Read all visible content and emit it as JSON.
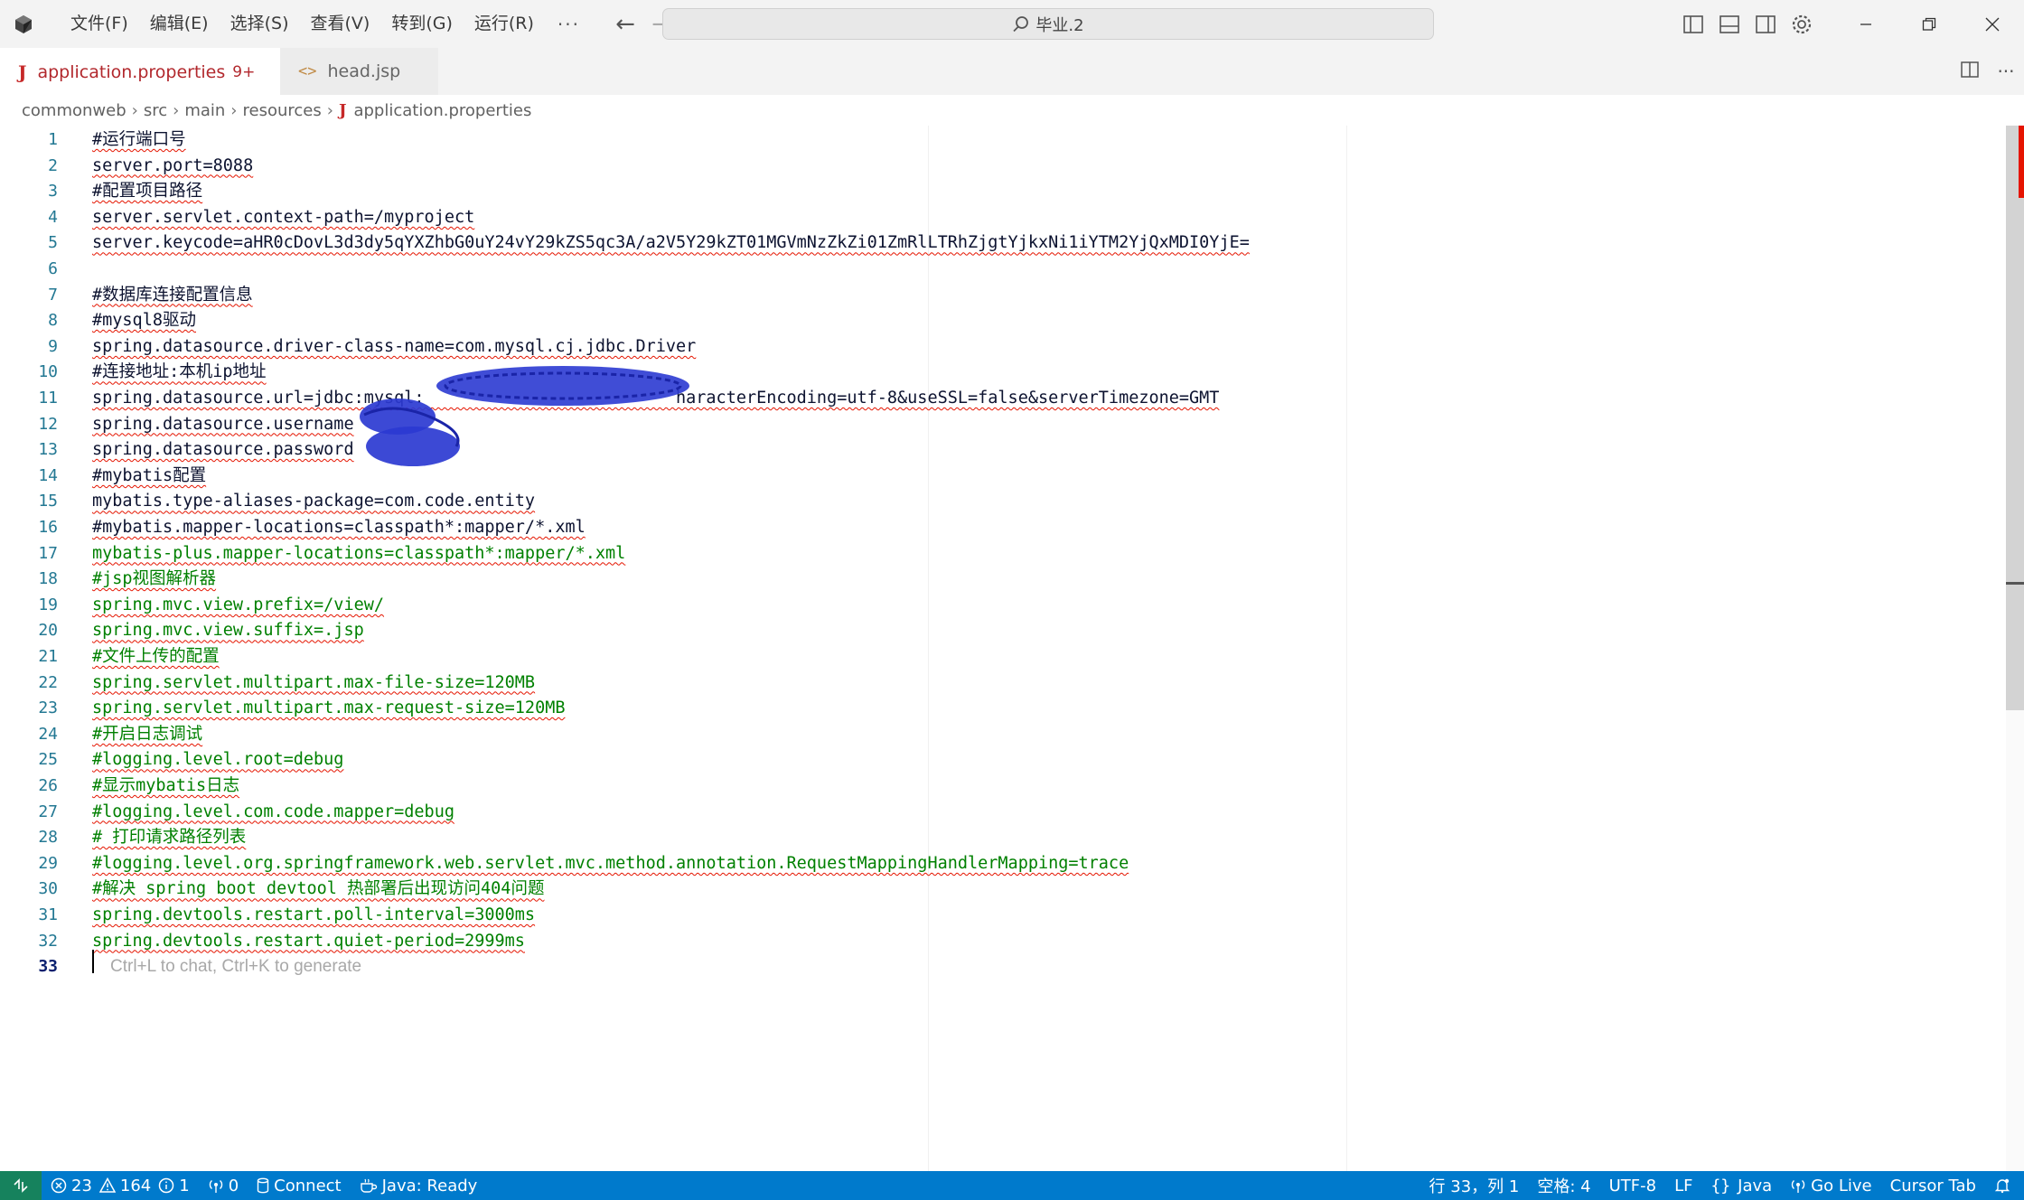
{
  "menu": [
    "文件(F)",
    "编辑(E)",
    "选择(S)",
    "查看(V)",
    "转到(G)",
    "运行(R)"
  ],
  "menu_more": "···",
  "search": {
    "text": "毕业.2"
  },
  "tabs": [
    {
      "label": "application.properties",
      "badge": "9+",
      "modified": true,
      "active": true,
      "icon": "java-icon"
    },
    {
      "label": "head.jsp",
      "active": false,
      "icon": "code-icon"
    }
  ],
  "breadcrumb": [
    "commonweb",
    "src",
    "main",
    "resources",
    "application.properties"
  ],
  "editor": {
    "current_line": 33,
    "ghost_hint": "Ctrl+L to chat, Ctrl+K to generate",
    "lines": [
      {
        "n": "1",
        "text": "#运行端口号",
        "kind": "key"
      },
      {
        "n": "2",
        "text": "server.port=8088",
        "kind": "key"
      },
      {
        "n": "3",
        "text": "#配置项目路径",
        "kind": "key"
      },
      {
        "n": "4",
        "text": "server.servlet.context-path=/myproject",
        "kind": "key"
      },
      {
        "n": "5",
        "text": "server.keycode=aHR0cDovL3d3dy5qYXZhbG0uY24vY29kZS5qc3A/a2V5Y29kZT01MGVmNzZkZi01ZmRlLTRhZjgtYjkxNi1iYTM2YjQxMDI0YjE=",
        "kind": "key"
      },
      {
        "n": "6",
        "text": "",
        "kind": "plain"
      },
      {
        "n": "7",
        "text": "#数据库连接配置信息",
        "kind": "key"
      },
      {
        "n": "8",
        "text": "#mysql8驱动",
        "kind": "key"
      },
      {
        "n": "9",
        "text": "spring.datasource.driver-class-name=com.mysql.cj.jdbc.Driver",
        "kind": "key"
      },
      {
        "n": "10",
        "text": "#连接地址:本机ip地址",
        "kind": "key"
      },
      {
        "n": "11",
        "text": "spring.datasource.url=jdbc:mysql:                         haracterEncoding=utf-8&useSSL=false&serverTimezone=GMT",
        "kind": "key"
      },
      {
        "n": "12",
        "text": "spring.datasource.username",
        "kind": "key"
      },
      {
        "n": "13",
        "text": "spring.datasource.password",
        "kind": "key"
      },
      {
        "n": "14",
        "text": "#mybatis配置",
        "kind": "key"
      },
      {
        "n": "15",
        "text": "mybatis.type-aliases-package=com.code.entity",
        "kind": "key"
      },
      {
        "n": "16",
        "text": "#mybatis.mapper-locations=classpath*:mapper/*.xml",
        "kind": "key"
      },
      {
        "n": "17",
        "text": "mybatis-plus.mapper-locations=classpath*:mapper/*.xml",
        "kind": "comment"
      },
      {
        "n": "18",
        "text": "#jsp视图解析器",
        "kind": "comment"
      },
      {
        "n": "19",
        "text": "spring.mvc.view.prefix=/view/",
        "kind": "comment"
      },
      {
        "n": "20",
        "text": "spring.mvc.view.suffix=.jsp",
        "kind": "comment"
      },
      {
        "n": "21",
        "text": "#文件上传的配置",
        "kind": "comment"
      },
      {
        "n": "22",
        "text": "spring.servlet.multipart.max-file-size=120MB",
        "kind": "comment"
      },
      {
        "n": "23",
        "text": "spring.servlet.multipart.max-request-size=120MB",
        "kind": "comment"
      },
      {
        "n": "24",
        "text": "#开启日志调试",
        "kind": "comment"
      },
      {
        "n": "25",
        "text": "#logging.level.root=debug",
        "kind": "comment"
      },
      {
        "n": "26",
        "text": "#显示mybatis日志",
        "kind": "comment"
      },
      {
        "n": "27",
        "text": "#logging.level.com.code.mapper=debug",
        "kind": "comment"
      },
      {
        "n": "28",
        "text": "# 打印请求路径列表",
        "kind": "comment"
      },
      {
        "n": "29",
        "text": "#logging.level.org.springframework.web.servlet.mvc.method.annotation.RequestMappingHandlerMapping=trace",
        "kind": "comment"
      },
      {
        "n": "30",
        "text": "#解决 spring boot devtool 热部署后出现访问404问题",
        "kind": "comment"
      },
      {
        "n": "31",
        "text": "spring.devtools.restart.poll-interval=3000ms",
        "kind": "comment"
      },
      {
        "n": "32",
        "text": "spring.devtools.restart.quiet-period=2999ms",
        "kind": "comment"
      },
      {
        "n": "33",
        "text": "",
        "kind": "plain"
      }
    ]
  },
  "statusbar": {
    "errors": "23",
    "warnings": "164",
    "infos": "1",
    "ports": "0",
    "connect": "Connect",
    "java": "Java: Ready",
    "position": "行 33，列 1",
    "spaces": "空格: 4",
    "encoding": "UTF-8",
    "eol": "LF",
    "language": "Java",
    "golive": "Go Live",
    "cursor_tab": "Cursor Tab"
  },
  "colors": {
    "statusbar": "#007acc",
    "remote": "#16825d",
    "comment": "#008000",
    "line_number": "#237893",
    "squiggle": "#e51400",
    "redaction": "#2b3ad1"
  }
}
